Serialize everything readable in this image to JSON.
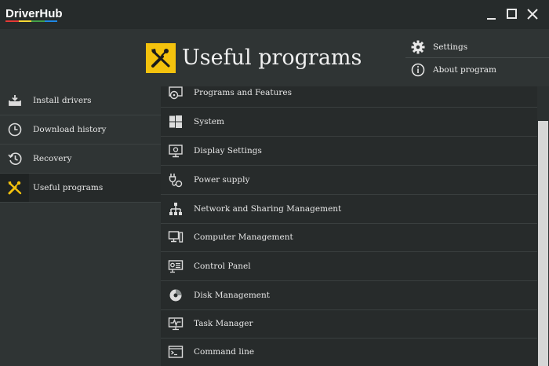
{
  "app": {
    "title": "DriverHub",
    "logo_colors": [
      "#e53935",
      "#fdd835",
      "#43a047",
      "#1e88e5"
    ]
  },
  "window_controls": [
    "minimize-icon",
    "maximize-icon",
    "close-icon"
  ],
  "header": {
    "title": "Useful programs",
    "icon": "tools-icon",
    "accent": "#f4c20d"
  },
  "top_menu": [
    {
      "label": "Settings",
      "icon": "gear-icon"
    },
    {
      "label": "About program",
      "icon": "info-icon"
    }
  ],
  "sidebar": {
    "items": [
      {
        "label": "Install drivers",
        "icon": "install-tray-icon",
        "active": false
      },
      {
        "label": "Download history",
        "icon": "clock-icon",
        "active": false
      },
      {
        "label": "Recovery",
        "icon": "history-icon",
        "active": false
      },
      {
        "label": "Useful programs",
        "icon": "tools-icon",
        "active": true
      }
    ]
  },
  "programs": [
    {
      "label": "Programs and Features",
      "icon": "programs-features-icon"
    },
    {
      "label": "System",
      "icon": "windows-icon"
    },
    {
      "label": "Display Settings",
      "icon": "display-icon"
    },
    {
      "label": "Power supply",
      "icon": "power-plug-icon"
    },
    {
      "label": "Network and Sharing Management",
      "icon": "network-icon"
    },
    {
      "label": "Computer Management",
      "icon": "computer-icon"
    },
    {
      "label": "Control Panel",
      "icon": "control-panel-icon"
    },
    {
      "label": "Disk Management",
      "icon": "disk-icon"
    },
    {
      "label": "Task Manager",
      "icon": "task-manager-icon"
    },
    {
      "label": "Command line",
      "icon": "command-line-icon"
    }
  ]
}
